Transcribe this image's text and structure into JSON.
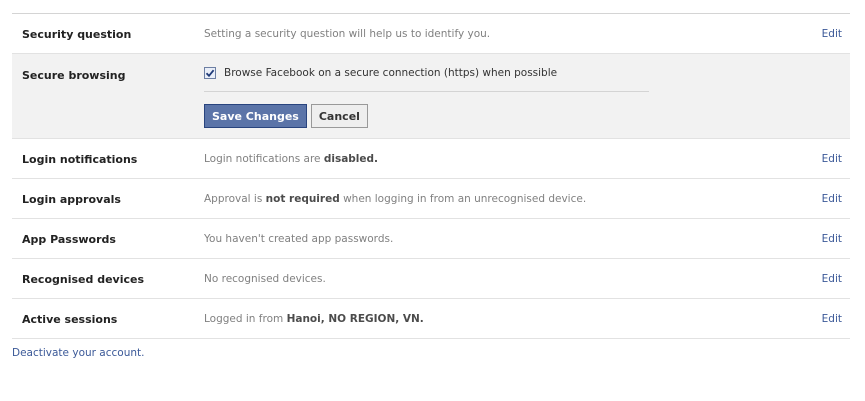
{
  "settings": [
    {
      "label": "Security question",
      "description": "Setting a security question will help us to identify you.",
      "edit": "Edit"
    },
    {
      "label": "Secure browsing",
      "checkbox_label": "Browse Facebook on a secure connection (https) when possible",
      "checked": true,
      "save_label": "Save Changes",
      "cancel_label": "Cancel"
    },
    {
      "label": "Login notifications",
      "description_prefix": "Login notifications are ",
      "description_bold": "disabled.",
      "edit": "Edit"
    },
    {
      "label": "Login approvals",
      "description_prefix": "Approval is ",
      "description_bold": "not required",
      "description_suffix": " when logging in from an unrecognised device.",
      "edit": "Edit"
    },
    {
      "label": "App Passwords",
      "description": "You haven't created app passwords.",
      "edit": "Edit"
    },
    {
      "label": "Recognised devices",
      "description": "No recognised devices.",
      "edit": "Edit"
    },
    {
      "label": "Active sessions",
      "description_prefix": "Logged in from ",
      "description_bold": "Hanoi, NO REGION, VN.",
      "edit": "Edit"
    }
  ],
  "footer": {
    "deactivate_link": "Deactivate your account."
  },
  "colors": {
    "link": "#3b5998",
    "primary_button": "#5b74a8",
    "expanded_row_bg": "#f2f2f2"
  }
}
